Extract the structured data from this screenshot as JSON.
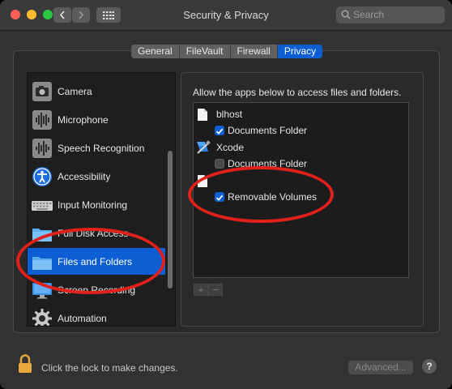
{
  "window": {
    "title": "Security & Privacy"
  },
  "search": {
    "placeholder": "Search"
  },
  "tabs": [
    {
      "label": "General",
      "active": false
    },
    {
      "label": "FileVault",
      "active": false
    },
    {
      "label": "Firewall",
      "active": false
    },
    {
      "label": "Privacy",
      "active": true
    }
  ],
  "sidebar": {
    "items": [
      {
        "label": "Camera",
        "icon": "camera-icon"
      },
      {
        "label": "Microphone",
        "icon": "microphone-icon"
      },
      {
        "label": "Speech Recognition",
        "icon": "speech-recognition-icon"
      },
      {
        "label": "Accessibility",
        "icon": "accessibility-icon"
      },
      {
        "label": "Input Monitoring",
        "icon": "keyboard-icon"
      },
      {
        "label": "Full Disk Access",
        "icon": "folder-icon"
      },
      {
        "label": "Files and Folders",
        "icon": "folder-icon",
        "selected": true
      },
      {
        "label": "Screen Recording",
        "icon": "display-icon"
      },
      {
        "label": "Automation",
        "icon": "gear-icon"
      }
    ]
  },
  "main": {
    "description": "Allow the apps below to access files and folders.",
    "apps": [
      {
        "name": "blhost",
        "icon": "document-icon",
        "permissions": [
          {
            "label": "Documents Folder",
            "checked": true
          }
        ]
      },
      {
        "name": "Xcode",
        "icon": "xcode-icon",
        "permissions": [
          {
            "label": "Documents Folder",
            "checked": false
          }
        ]
      },
      {
        "name": "",
        "icon": "document-icon",
        "permissions": [
          {
            "label": "Removable Volumes",
            "checked": true
          }
        ]
      }
    ],
    "add_label": "+",
    "remove_label": "−"
  },
  "footer": {
    "lock_message": "Click the lock to make changes.",
    "advanced_label": "Advanced...",
    "help_label": "?"
  },
  "colors": {
    "accent": "#0c5ed2",
    "annotation": "#e0201b"
  }
}
